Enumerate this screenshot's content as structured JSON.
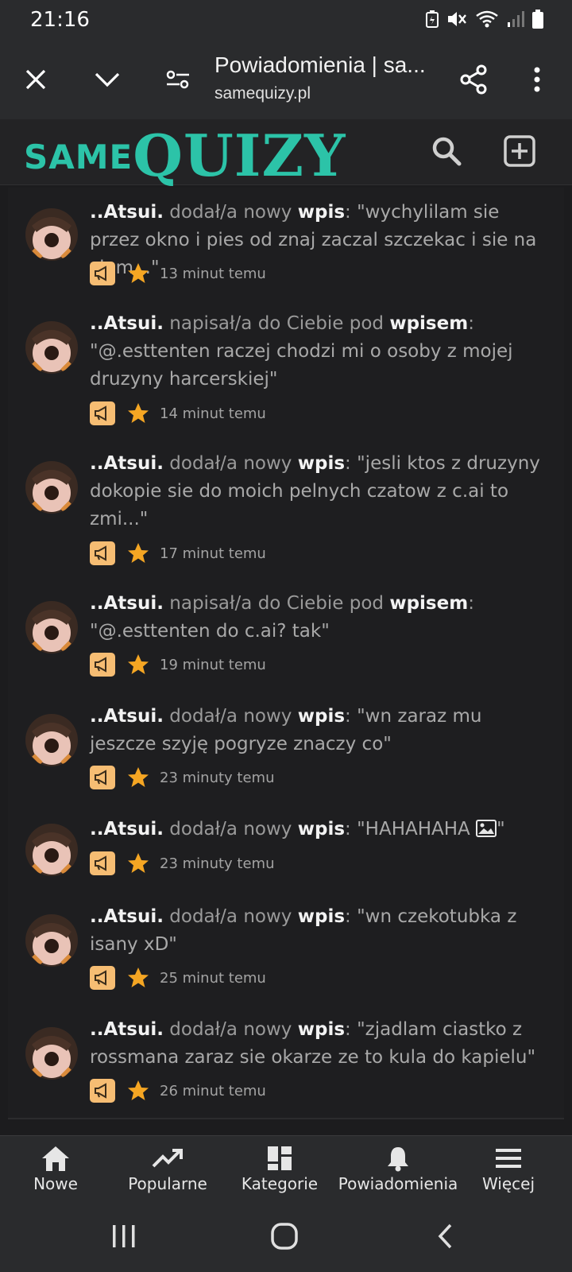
{
  "status_bar": {
    "time": "21:16"
  },
  "browser": {
    "page_title": "Powiadomienia | sa...",
    "url": "samequizy.pl"
  },
  "site": {
    "logo_small": "SAME",
    "logo_big": "QUIZY"
  },
  "notifications": [
    {
      "user": "..Atsui.",
      "action": "dodał/a nowy",
      "kind": "wpis",
      "quote": "\"wychylilam sie przez okno i pies od znaj zaczal szczekac i sie na ziem...\"",
      "time": "13 minut temu"
    },
    {
      "user": "..Atsui.",
      "action": "napisał/a do Ciebie pod",
      "kind": "wpisem",
      "quote": "\"@.esttenten raczej chodzi mi o osoby z mojej druzyny harcerskiej\"",
      "time": "14 minut temu"
    },
    {
      "user": "..Atsui.",
      "action": "dodał/a nowy",
      "kind": "wpis",
      "quote": "\"jesli ktos z druzyny dokopie sie do moich pelnych czatow z c.ai to zmi...\"",
      "time": "17 minut temu"
    },
    {
      "user": "..Atsui.",
      "action": "napisał/a do Ciebie pod",
      "kind": "wpisem",
      "quote": "\"@.esttenten do c.ai? tak\"",
      "time": "19 minut temu"
    },
    {
      "user": "..Atsui.",
      "action": "dodał/a nowy",
      "kind": "wpis",
      "quote": "\"wn zaraz mu jeszcze szyję pogryze znaczy co\"",
      "time": "23 minuty temu"
    },
    {
      "user": "..Atsui.",
      "action": "dodał/a nowy",
      "kind": "wpis",
      "quote": "\"HAHAHAHA \"",
      "time": "23 minuty temu",
      "has_image": true
    },
    {
      "user": "..Atsui.",
      "action": "dodał/a nowy",
      "kind": "wpis",
      "quote": "\"wn czekotubka z isany xD\"",
      "time": "25 minut temu"
    },
    {
      "user": "..Atsui.",
      "action": "dodał/a nowy",
      "kind": "wpis",
      "quote": "\"zjadlam ciastko z rossmana zaraz sie okarze ze to kula do kapielu\"",
      "time": "26 minut temu"
    }
  ],
  "bottom_nav": [
    {
      "label": "Nowe",
      "icon": "home-icon"
    },
    {
      "label": "Popularne",
      "icon": "trending-icon"
    },
    {
      "label": "Kategorie",
      "icon": "categories-icon"
    },
    {
      "label": "Powiadomienia",
      "icon": "bell-icon"
    },
    {
      "label": "Więcej",
      "icon": "menu-icon"
    }
  ],
  "colors": {
    "brand": "#2cc3a8",
    "badge": "#f6bd73",
    "star": "#f5a623",
    "background": "#1c1c1e"
  }
}
